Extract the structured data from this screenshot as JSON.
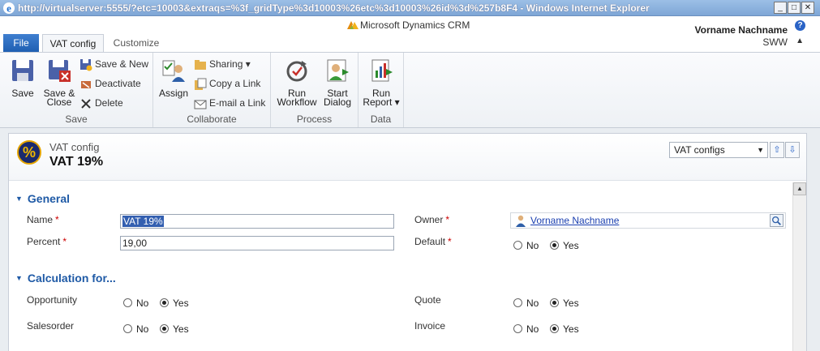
{
  "window": {
    "title": "http://virtualserver:5555/?etc=10003&extraqs=%3f_gridType%3d10003%26etc%3d10003%26id%3d%257b8F4 - Windows Internet Explorer",
    "minimize": "_",
    "maximize": "□",
    "close": "✕"
  },
  "header": {
    "product": "Microsoft Dynamics CRM",
    "user_name": "Vorname Nachname",
    "org": "SWW",
    "help": "?",
    "collapse": "▲"
  },
  "tabs": [
    {
      "label": "File"
    },
    {
      "label": "VAT config"
    },
    {
      "label": "Customize"
    }
  ],
  "ribbon": {
    "save": {
      "label": "Save",
      "save": "Save",
      "save_close_1": "Save &",
      "save_close_2": "Close",
      "save_new": "Save & New",
      "deactivate": "Deactivate",
      "delete": "Delete"
    },
    "collaborate": {
      "label": "Collaborate",
      "assign": "Assign",
      "sharing": "Sharing ▾",
      "copy_link": "Copy a Link",
      "email_link": "E-mail a Link"
    },
    "process": {
      "label": "Process",
      "run_workflow_1": "Run",
      "run_workflow_2": "Workflow",
      "start_dialog_1": "Start",
      "start_dialog_2": "Dialog"
    },
    "data": {
      "label": "Data",
      "run_report_1": "Run",
      "run_report_2": "Report ▾"
    }
  },
  "record": {
    "entity_icon": "%",
    "entity_type": "VAT config",
    "title": "VAT 19%",
    "view_selector": "VAT configs",
    "nav_up": "⇧",
    "nav_down": "⇩"
  },
  "sections": {
    "general": {
      "title": "General",
      "name_label": "Name",
      "name_value": "VAT 19%",
      "percent_label": "Percent",
      "percent_value": "19,00",
      "owner_label": "Owner",
      "owner_value": "Vorname Nachname",
      "default_label": "Default",
      "default_no": "No",
      "default_yes": "Yes",
      "default_selected": "Yes"
    },
    "calculation": {
      "title": "Calculation for...",
      "opportunity_label": "Opportunity",
      "quote_label": "Quote",
      "salesorder_label": "Salesorder",
      "invoice_label": "Invoice",
      "no": "No",
      "yes": "Yes"
    }
  },
  "required_marker": "*",
  "colors": {
    "accent": "#1f5aa6",
    "file_tab": "#2a6ac4",
    "required": "#cc0000"
  }
}
